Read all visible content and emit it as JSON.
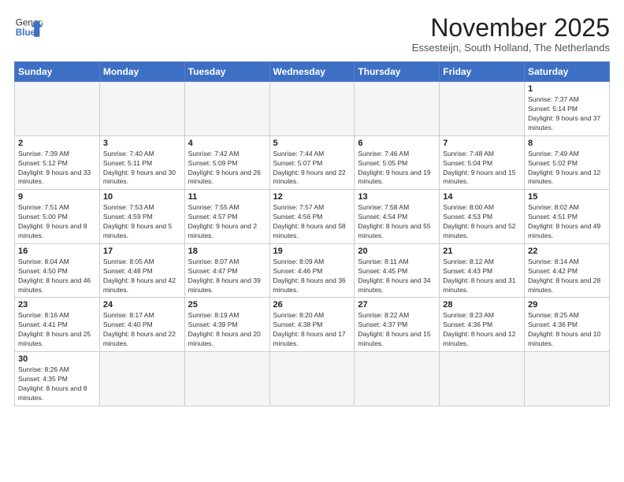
{
  "logo": {
    "text_general": "General",
    "text_blue": "Blue"
  },
  "header": {
    "month_title": "November 2025",
    "subtitle": "Essesteijn, South Holland, The Netherlands"
  },
  "weekdays": [
    "Sunday",
    "Monday",
    "Tuesday",
    "Wednesday",
    "Thursday",
    "Friday",
    "Saturday"
  ],
  "weeks": [
    [
      {
        "day": "",
        "info": ""
      },
      {
        "day": "",
        "info": ""
      },
      {
        "day": "",
        "info": ""
      },
      {
        "day": "",
        "info": ""
      },
      {
        "day": "",
        "info": ""
      },
      {
        "day": "",
        "info": ""
      },
      {
        "day": "1",
        "info": "Sunrise: 7:37 AM\nSunset: 5:14 PM\nDaylight: 9 hours and 37 minutes."
      }
    ],
    [
      {
        "day": "2",
        "info": "Sunrise: 7:39 AM\nSunset: 5:12 PM\nDaylight: 9 hours and 33 minutes."
      },
      {
        "day": "3",
        "info": "Sunrise: 7:40 AM\nSunset: 5:11 PM\nDaylight: 9 hours and 30 minutes."
      },
      {
        "day": "4",
        "info": "Sunrise: 7:42 AM\nSunset: 5:09 PM\nDaylight: 9 hours and 26 minutes."
      },
      {
        "day": "5",
        "info": "Sunrise: 7:44 AM\nSunset: 5:07 PM\nDaylight: 9 hours and 22 minutes."
      },
      {
        "day": "6",
        "info": "Sunrise: 7:46 AM\nSunset: 5:05 PM\nDaylight: 9 hours and 19 minutes."
      },
      {
        "day": "7",
        "info": "Sunrise: 7:48 AM\nSunset: 5:04 PM\nDaylight: 9 hours and 15 minutes."
      },
      {
        "day": "8",
        "info": "Sunrise: 7:49 AM\nSunset: 5:02 PM\nDaylight: 9 hours and 12 minutes."
      }
    ],
    [
      {
        "day": "9",
        "info": "Sunrise: 7:51 AM\nSunset: 5:00 PM\nDaylight: 9 hours and 8 minutes."
      },
      {
        "day": "10",
        "info": "Sunrise: 7:53 AM\nSunset: 4:59 PM\nDaylight: 9 hours and 5 minutes."
      },
      {
        "day": "11",
        "info": "Sunrise: 7:55 AM\nSunset: 4:57 PM\nDaylight: 9 hours and 2 minutes."
      },
      {
        "day": "12",
        "info": "Sunrise: 7:57 AM\nSunset: 4:56 PM\nDaylight: 8 hours and 58 minutes."
      },
      {
        "day": "13",
        "info": "Sunrise: 7:58 AM\nSunset: 4:54 PM\nDaylight: 8 hours and 55 minutes."
      },
      {
        "day": "14",
        "info": "Sunrise: 8:00 AM\nSunset: 4:53 PM\nDaylight: 8 hours and 52 minutes."
      },
      {
        "day": "15",
        "info": "Sunrise: 8:02 AM\nSunset: 4:51 PM\nDaylight: 8 hours and 49 minutes."
      }
    ],
    [
      {
        "day": "16",
        "info": "Sunrise: 8:04 AM\nSunset: 4:50 PM\nDaylight: 8 hours and 46 minutes."
      },
      {
        "day": "17",
        "info": "Sunrise: 8:05 AM\nSunset: 4:48 PM\nDaylight: 8 hours and 42 minutes."
      },
      {
        "day": "18",
        "info": "Sunrise: 8:07 AM\nSunset: 4:47 PM\nDaylight: 8 hours and 39 minutes."
      },
      {
        "day": "19",
        "info": "Sunrise: 8:09 AM\nSunset: 4:46 PM\nDaylight: 8 hours and 36 minutes."
      },
      {
        "day": "20",
        "info": "Sunrise: 8:11 AM\nSunset: 4:45 PM\nDaylight: 8 hours and 34 minutes."
      },
      {
        "day": "21",
        "info": "Sunrise: 8:12 AM\nSunset: 4:43 PM\nDaylight: 8 hours and 31 minutes."
      },
      {
        "day": "22",
        "info": "Sunrise: 8:14 AM\nSunset: 4:42 PM\nDaylight: 8 hours and 28 minutes."
      }
    ],
    [
      {
        "day": "23",
        "info": "Sunrise: 8:16 AM\nSunset: 4:41 PM\nDaylight: 8 hours and 25 minutes."
      },
      {
        "day": "24",
        "info": "Sunrise: 8:17 AM\nSunset: 4:40 PM\nDaylight: 8 hours and 22 minutes."
      },
      {
        "day": "25",
        "info": "Sunrise: 8:19 AM\nSunset: 4:39 PM\nDaylight: 8 hours and 20 minutes."
      },
      {
        "day": "26",
        "info": "Sunrise: 8:20 AM\nSunset: 4:38 PM\nDaylight: 8 hours and 17 minutes."
      },
      {
        "day": "27",
        "info": "Sunrise: 8:22 AM\nSunset: 4:37 PM\nDaylight: 8 hours and 15 minutes."
      },
      {
        "day": "28",
        "info": "Sunrise: 8:23 AM\nSunset: 4:36 PM\nDaylight: 8 hours and 12 minutes."
      },
      {
        "day": "29",
        "info": "Sunrise: 8:25 AM\nSunset: 4:36 PM\nDaylight: 8 hours and 10 minutes."
      }
    ],
    [
      {
        "day": "30",
        "info": "Sunrise: 8:26 AM\nSunset: 4:35 PM\nDaylight: 8 hours and 8 minutes."
      },
      {
        "day": "",
        "info": ""
      },
      {
        "day": "",
        "info": ""
      },
      {
        "day": "",
        "info": ""
      },
      {
        "day": "",
        "info": ""
      },
      {
        "day": "",
        "info": ""
      },
      {
        "day": "",
        "info": ""
      }
    ]
  ]
}
